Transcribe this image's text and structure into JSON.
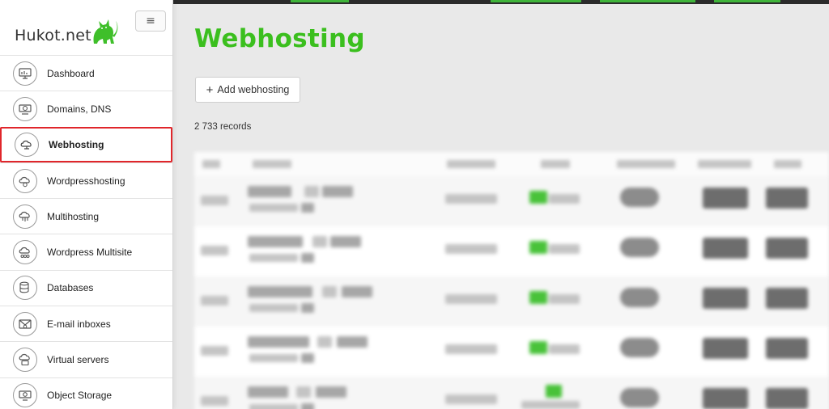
{
  "app": {
    "brand": "Hukot.net",
    "menu_toggle": "≡"
  },
  "colors": {
    "accent_green": "#3bbf1e",
    "active_border": "#e0262b"
  },
  "sidebar": {
    "items": [
      {
        "label": "Dashboard",
        "icon": "dashboard-icon",
        "active": false
      },
      {
        "label": "Domains, DNS",
        "icon": "domains-icon",
        "active": false
      },
      {
        "label": "Webhosting",
        "icon": "cloud-icon",
        "active": true
      },
      {
        "label": "Wordpresshosting",
        "icon": "wordpress-icon",
        "active": false
      },
      {
        "label": "Multihosting",
        "icon": "multihosting-icon",
        "active": false
      },
      {
        "label": "Wordpress Multisite",
        "icon": "multisite-icon",
        "active": false
      },
      {
        "label": "Databases",
        "icon": "database-icon",
        "active": false
      },
      {
        "label": "E-mail inboxes",
        "icon": "email-icon",
        "active": false
      },
      {
        "label": "Virtual servers",
        "icon": "server-icon",
        "active": false
      },
      {
        "label": "Object Storage",
        "icon": "storage-icon",
        "active": false
      }
    ]
  },
  "main": {
    "title": "Webhosting",
    "add_button": "Add webhosting",
    "records": "2 733 records"
  }
}
